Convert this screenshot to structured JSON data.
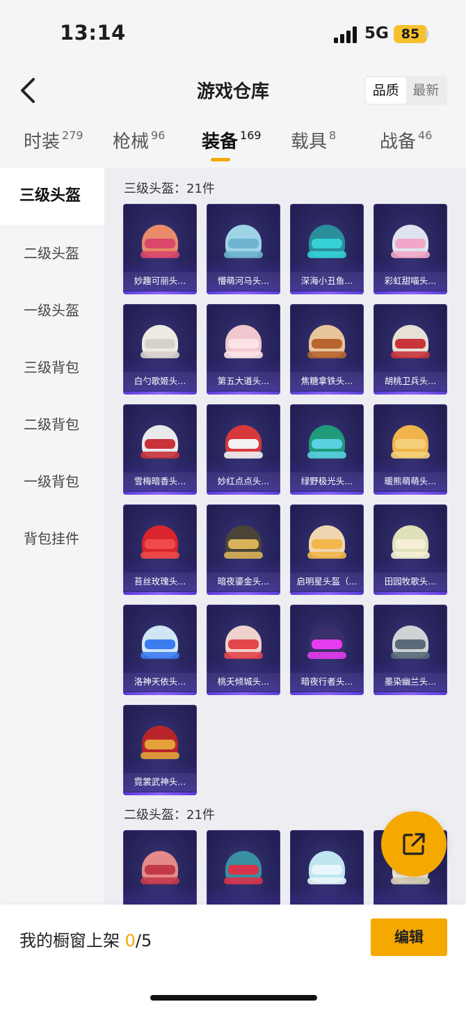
{
  "status_bar": {
    "time": "13:14",
    "network": "5G",
    "battery": "85"
  },
  "header": {
    "title": "游戏仓库",
    "sort_options": [
      "品质",
      "最新"
    ],
    "sort_active": "品质"
  },
  "tabs": [
    {
      "label": "时装",
      "count": "279"
    },
    {
      "label": "枪械",
      "count": "96"
    },
    {
      "label": "装备",
      "count": "169",
      "active": true
    },
    {
      "label": "载具",
      "count": "8"
    },
    {
      "label": "战备",
      "count": "46"
    }
  ],
  "sidebar": {
    "items": [
      "三级头盔",
      "二级头盔",
      "一级头盔",
      "三级背包",
      "二级背包",
      "一级背包",
      "背包挂件"
    ],
    "active": "三级头盔"
  },
  "sections": [
    {
      "title": "三级头盔：21件",
      "items": [
        {
          "name": "妙趣可丽头...",
          "color": "#e98a6a",
          "accent": "#d9476a"
        },
        {
          "name": "懵萌河马头...",
          "color": "#9fd3e6",
          "accent": "#6fb4cf"
        },
        {
          "name": "深海小丑鱼...",
          "color": "#2a8f9a",
          "accent": "#35d1d6"
        },
        {
          "name": "彩虹甜喵头...",
          "color": "#dfe3ef",
          "accent": "#f2a7c8"
        },
        {
          "name": "白勺歌姬头...",
          "color": "#eeeae4",
          "accent": "#d6d2cc"
        },
        {
          "name": "第五大道头...",
          "color": "#f1c7cf",
          "accent": "#fbe3e6"
        },
        {
          "name": "焦糖拿铁头...",
          "color": "#e9c59b",
          "accent": "#b8652f"
        },
        {
          "name": "胡桃卫兵头...",
          "color": "#e6e0d6",
          "accent": "#c9343a"
        },
        {
          "name": "雪梅暗香头...",
          "color": "#e9e9ec",
          "accent": "#c8323b"
        },
        {
          "name": "妙红点点头...",
          "color": "#d8383c",
          "accent": "#f2f2f2"
        },
        {
          "name": "绿野极光头...",
          "color": "#1f9a7a",
          "accent": "#5ad0e0"
        },
        {
          "name": "暖熊萌萌头...",
          "color": "#f0b44a",
          "accent": "#f5d07a"
        },
        {
          "name": "苔丝玫瑰头...",
          "color": "#d9252e",
          "accent": "#f04a4a"
        },
        {
          "name": "暗夜鎏金头...",
          "color": "#4a4438",
          "accent": "#d7b25a"
        },
        {
          "name": "启明星头盔（...",
          "color": "#f0d6b0",
          "accent": "#f3b64b"
        },
        {
          "name": "田园牧歌头...",
          "color": "#dfe2b8",
          "accent": "#f4efd6"
        },
        {
          "name": "洛神天依头...",
          "color": "#cfe6f4",
          "accent": "#3b7cf0"
        },
        {
          "name": "桃夭倾城头...",
          "color": "#f0d2cc",
          "accent": "#e2464b"
        },
        {
          "name": "暗夜行者头...",
          "color": "#3a2f6a",
          "accent": "#e63cf0"
        },
        {
          "name": "墨染幽兰头...",
          "color": "#cfd3d6",
          "accent": "#5a6a7a"
        },
        {
          "name": "霓裳武神头...",
          "color": "#b8252c",
          "accent": "#e6a23a"
        }
      ]
    },
    {
      "title": "二级头盔：21件",
      "items": [
        {
          "name": "",
          "color": "#e58a8a",
          "accent": "#c23a4a"
        },
        {
          "name": "",
          "color": "#3a8fa0",
          "accent": "#d8334a"
        },
        {
          "name": "",
          "color": "#bfe6f0",
          "accent": "#e8f6fb"
        },
        {
          "name": "",
          "color": "#f4efe0",
          "accent": "#d6cfb8"
        }
      ]
    }
  ],
  "bottom": {
    "label": "我的橱窗上架",
    "current": "0",
    "total": "/5",
    "edit_label": "编辑"
  }
}
